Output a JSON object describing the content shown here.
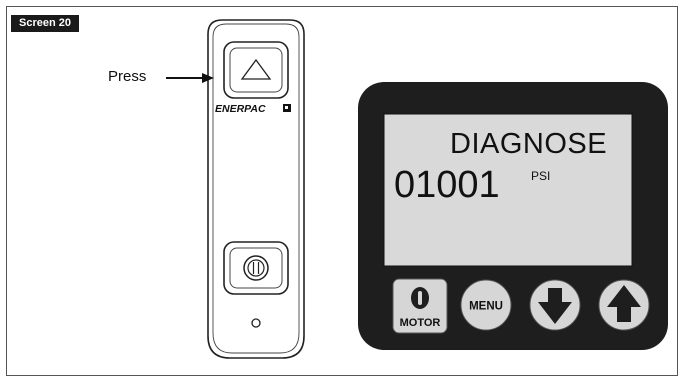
{
  "figure": {
    "screen_label": "Screen 20",
    "press_label": "Press"
  },
  "pendant": {
    "brand": "ENERPAC",
    "up_button_icon": "triangle-up-icon",
    "motor_button_icon": "motor-power-icon",
    "indicator_icon": "circle-indicator-icon"
  },
  "display_unit": {
    "lcd": {
      "mode_text": "DIAGNOSE",
      "pressure_value": "01001",
      "pressure_unit": "PSI"
    },
    "buttons": {
      "motor_label": "MOTOR",
      "menu_label": "MENU",
      "down_icon": "arrow-down-icon",
      "up_icon": "arrow-up-icon"
    },
    "colors": {
      "bezel": "#1e1e1e",
      "lcd_background": "#d9d9d9",
      "button_face": "#d6d6d6"
    }
  }
}
